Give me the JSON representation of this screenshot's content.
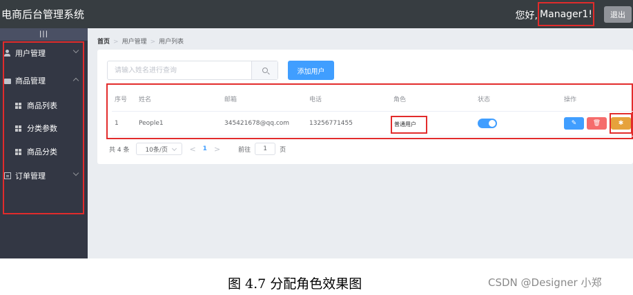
{
  "header": {
    "title": "电商后台管理系统",
    "greeting": "您好,",
    "username": "Manager1!",
    "logout_label": "退出"
  },
  "sidebar": {
    "toggle_label": "|||",
    "items": [
      {
        "label": "用户管理",
        "icon": "user-icon"
      },
      {
        "label": "商品管理",
        "icon": "bag-icon"
      },
      {
        "label": "订单管理",
        "icon": "order-icon"
      }
    ],
    "sub_items": [
      {
        "label": "商品列表"
      },
      {
        "label": "分类参数"
      },
      {
        "label": "商品分类"
      }
    ]
  },
  "breadcrumb": [
    "首页",
    "用户管理",
    "用户列表"
  ],
  "search": {
    "placeholder": "请输入姓名进行查询"
  },
  "add_button_label": "添加用户",
  "table": {
    "headers": [
      "序号",
      "姓名",
      "邮箱",
      "电话",
      "角色",
      "状态",
      "操作"
    ],
    "rows": [
      {
        "index": "1",
        "name": "People1",
        "email": "345421678@qq.com",
        "phone": "13256771455",
        "role": "普通用户",
        "status_on": true
      }
    ]
  },
  "pagination": {
    "total_label": "共 4 条",
    "page_size_label": "10条/页",
    "prev": "<",
    "current_page": "1",
    "next": ">",
    "goto_label": "前往",
    "goto_value": "1",
    "page_suffix": "页"
  },
  "caption": "图 4.7  分配角色效果图",
  "watermark": "CSDN @Designer 小郑",
  "colors": {
    "header_bg": "#373d41",
    "sidebar_bg": "#333744",
    "primary": "#409eff",
    "danger": "#f56c6c",
    "warning": "#e6a23c",
    "highlight_border": "#e22b2b"
  }
}
